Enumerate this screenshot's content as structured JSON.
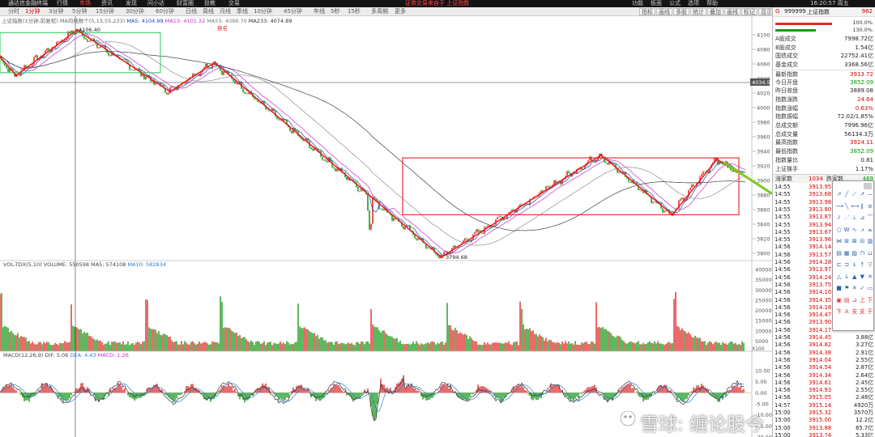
{
  "topbar": {
    "app": "通达信金融终端",
    "menus": [
      "行情",
      "市场",
      "资讯",
      "发现",
      "问小达",
      "财富圈",
      "投教",
      "交易"
    ],
    "notice": "证券交易来自于 上证指数",
    "right_menus": [
      "功能",
      "板面",
      "公式",
      "选项",
      "帮助"
    ],
    "clock": "16:20:57 周五"
  },
  "periods": [
    "分时",
    "1分钟",
    "3分钟",
    "5分钟",
    "15分钟",
    "30分钟",
    "60分钟",
    "日线",
    "周线",
    "月线",
    "季线",
    "10分钟",
    "45分钟",
    "年线",
    "5秒",
    "15秒",
    "多周期",
    "更多"
  ],
  "period_active": "1分钟",
  "tools": [
    "指标",
    "画线",
    "多股",
    "统计",
    "叠加",
    "画线",
    "标记",
    "显示",
    "设置"
  ],
  "legend": {
    "title": "上证指数(1分钟,前复权)",
    "ma_prefix": "MA均线数个(5,13,55,233)",
    "ma5": "MA5: 4104.99",
    "ma13": "MA13: 4101.32",
    "ma55": "MA55: 4088.70",
    "ma233": "MA233: 4074.89",
    "red_note": "换名"
  },
  "price_axis": [
    "4100",
    "4080",
    "4060",
    "4040",
    "4020",
    "4000",
    "3980",
    "3960",
    "3940",
    "3920",
    "3900",
    "3880",
    "3860",
    "3840",
    "3820",
    "3800"
  ],
  "price_badge": "4034.5",
  "annotations": {
    "high": "4106.40",
    "low": "3794.68"
  },
  "volume_legend": {
    "name": "VOL-TDX(5,10)",
    "vol": "VOLUME: 550598",
    "ma5": "MA5: 574108",
    "ma10": "MA10: 582834"
  },
  "volume_axis": [
    "40000",
    "35000",
    "30000",
    "25000",
    "20000",
    "15000",
    "10000",
    "5000"
  ],
  "volume_unit": "X100",
  "macd_legend": {
    "name": "MACD(12,26,9)",
    "dif": "DIF: 5.06",
    "dea": "DEA: 4.43",
    "macd": "MACD: 1.26"
  },
  "macd_axis": [
    "10.00",
    "5.00",
    "0.00",
    "-5.00",
    "-10.00",
    "-15.00",
    "-20.00"
  ],
  "sidepanel": {
    "code": "999999",
    "name": "上证指数",
    "letter": "G",
    "badge": "962",
    "pct_top": "100.0%",
    "pct_bottom": "130.0%",
    "rows": [
      {
        "k": "A股成交",
        "v": "7998.72亿",
        "c": "#222"
      },
      {
        "k": "B股成交",
        "v": "1.54亿",
        "c": "#222"
      },
      {
        "k": "国债成交",
        "v": "22752.41亿",
        "c": "#222"
      },
      {
        "k": "基金成交",
        "v": "3368.56亿",
        "c": "#222"
      },
      {
        "k": "最新指数",
        "v": "3913.72",
        "c": "#d00"
      },
      {
        "k": "今日开盘",
        "v": "3852.09",
        "c": "#090"
      },
      {
        "k": "昨日收盘",
        "v": "3889.08",
        "c": "#222"
      },
      {
        "k": "指数涨跌",
        "v": "24.64",
        "c": "#d00"
      },
      {
        "k": "指数涨幅",
        "v": "0.63%",
        "c": "#d00"
      },
      {
        "k": "指数振幅",
        "v": "72.02/1.85%",
        "c": "#222"
      },
      {
        "k": "总成交额",
        "v": "7996.96亿",
        "c": "#222"
      },
      {
        "k": "总成交量",
        "v": "56134.3万",
        "c": "#222"
      },
      {
        "k": "最高指数",
        "v": "3924.11",
        "c": "#d00"
      },
      {
        "k": "最低指数",
        "v": "3852.09",
        "c": "#090"
      },
      {
        "k": "指数量比",
        "v": "0.81",
        "c": "#222"
      },
      {
        "k": "上证换手",
        "v": "1.17%",
        "c": "#222"
      }
    ],
    "updown_label": "涨家数",
    "up_count": "1034",
    "down_label": "跌家数",
    "down_count": "469"
  },
  "ticks": [
    {
      "t": "14:55",
      "p": "3913.95",
      "q": ""
    },
    {
      "t": "14:55",
      "p": "3913.68",
      "q": ""
    },
    {
      "t": "14:55",
      "p": "3913.98",
      "q": ""
    },
    {
      "t": "14:55",
      "p": "3913.80",
      "q": ""
    },
    {
      "t": "14:55",
      "p": "3913.87",
      "q": ""
    },
    {
      "t": "14:55",
      "p": "3913.94",
      "q": ""
    },
    {
      "t": "14:55",
      "p": "3913.67",
      "q": ""
    },
    {
      "t": "14:55",
      "p": "3913.96",
      "q": ""
    },
    {
      "t": "14:56",
      "p": "3914.14",
      "q": ""
    },
    {
      "t": "14:56",
      "p": "3913.57",
      "q": ""
    },
    {
      "t": "14:56",
      "p": "3914.28",
      "q": ""
    },
    {
      "t": "14:56",
      "p": "3913.97",
      "q": ""
    },
    {
      "t": "14:56",
      "p": "3914.24",
      "q": ""
    },
    {
      "t": "14:56",
      "p": "3913.75",
      "q": ""
    },
    {
      "t": "14:56",
      "p": "3914.10",
      "q": ""
    },
    {
      "t": "14:56",
      "p": "3914.35",
      "q": ""
    },
    {
      "t": "14:56",
      "p": "3914.18",
      "q": ""
    },
    {
      "t": "14:56",
      "p": "3914.47",
      "q": ""
    },
    {
      "t": "14:56",
      "p": "3913.90",
      "q": ""
    },
    {
      "t": "14:56",
      "p": "3914.17",
      "q": ""
    },
    {
      "t": "14:56",
      "p": "3914.45",
      "q": "3.88亿"
    },
    {
      "t": "14:56",
      "p": "3914.82",
      "q": "3.27亿"
    },
    {
      "t": "14:56",
      "p": "3914.38",
      "q": "2.91亿"
    },
    {
      "t": "14:56",
      "p": "3914.04",
      "q": "2.55亿"
    },
    {
      "t": "14:56",
      "p": "3914.54",
      "q": "2.87亿"
    },
    {
      "t": "14:56",
      "p": "3914.34",
      "q": "2.64亿"
    },
    {
      "t": "14:56",
      "p": "3914.61",
      "q": "2.45亿"
    },
    {
      "t": "14:56",
      "p": "3914.93",
      "q": "2.55亿"
    },
    {
      "t": "14:56",
      "p": "3915.05",
      "q": "2.48亿"
    },
    {
      "t": "14:57",
      "p": "3915.14",
      "q": "4920万"
    },
    {
      "t": "15:00",
      "p": "3915.32",
      "q": "3570万"
    },
    {
      "t": "15:00",
      "p": "3915.00",
      "q": "12.2亿"
    },
    {
      "t": "15:00",
      "p": "3913.88",
      "q": "65.7亿"
    },
    {
      "t": "15:00",
      "p": "3913.74",
      "q": "5.33亿"
    }
  ],
  "draw_tools": [
    "↗",
    "╱",
    "⟋",
    "↗",
    "—",
    "⟶",
    "╲",
    "⟷",
    "∥",
    "≡",
    "⫽",
    "⋰",
    "⊥",
    "⊿",
    "⌒",
    "○",
    "W",
    "∿",
    "⩘",
    "⩕",
    "⋈",
    "⊞",
    "⊠",
    "⊟",
    "▥",
    "▤",
    "▦",
    "▧",
    "⊓",
    "⊔",
    "⊏",
    "⊐",
    "↓",
    "↑",
    "▽",
    "△",
    "↓",
    "▲",
    "▼",
    "✕",
    "■",
    "⚑",
    "✕",
    "✓",
    "▭",
    "▣",
    "▤",
    "⊿",
    "上",
    "下",
    "卞",
    "A",
    "支",
    "支",
    "于",
    "",
    "",
    ""
  ],
  "colors": {
    "up": "#e42a2a",
    "down": "#1a9a1a",
    "zigzag": "#ee1c1c",
    "box_green": "#22cc55",
    "arrow": "#7dc81e",
    "ma5": "#2040c0",
    "ma13": "#c030c0",
    "ma55": "#909090",
    "ma233": "#404040"
  },
  "watermark": "雪球: 缠论股今"
}
